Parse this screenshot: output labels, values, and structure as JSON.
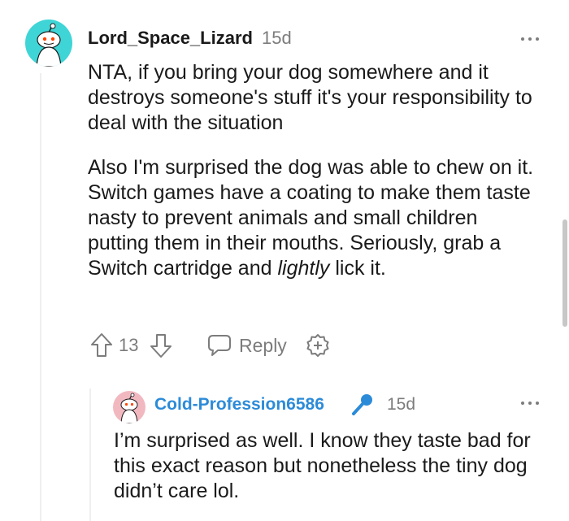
{
  "comment": {
    "username": "Lord_Space_Lizard",
    "age": "15d",
    "avatar_icon": "snoo-avatar-icon",
    "avatar_color": "#3fd5d6",
    "paragraphs": [
      "NTA, if you bring your dog somewhere and it destroys someone's stuff it's your responsibility to deal with the situation",
      "Also I'm surprised the dog was able to chew on it. Switch games have a coating to make them taste nasty to prevent animals and small children putting them in their mouths. Seriously, grab a Switch cartridge and"
    ],
    "emphasis": "lightly",
    "trailing": "lick it.",
    "score": "13",
    "reply_label": "Reply",
    "more_icon": "more-options-icon"
  },
  "reply": {
    "username": "Cold-Profession6586",
    "username_color": "#2c8bd8",
    "flair_icon": "microphone-icon",
    "age": "15d",
    "avatar_color": "#f2b8c0",
    "text": "I’m surprised as well. I know they taste bad for this exact reason but nonetheless the tiny dog didn’t care lol."
  }
}
